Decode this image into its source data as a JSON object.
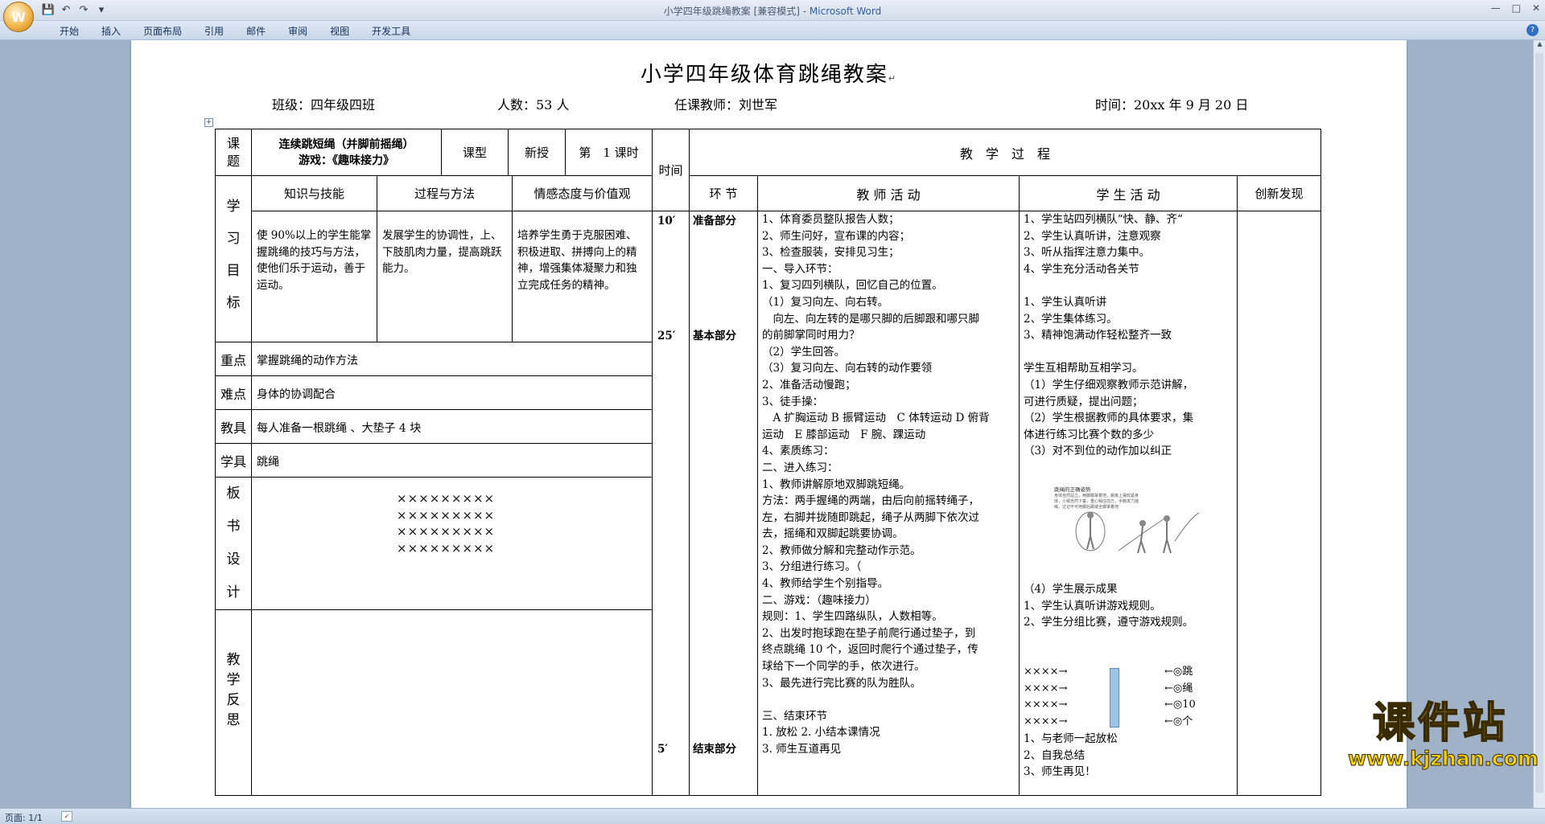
{
  "app": {
    "window_title": "小学四年级跳绳教案 [兼容模式] - ",
    "app_name": "Microsoft Word",
    "tabs": [
      "开始",
      "插入",
      "页面布局",
      "引用",
      "邮件",
      "审阅",
      "视图",
      "开发工具"
    ],
    "qat": [
      "save-icon",
      "undo-icon",
      "redo-icon",
      "customize-icon"
    ],
    "status": "页面: 1/1"
  },
  "doc": {
    "title": "小学四年级体育跳绳教案",
    "info": {
      "class": "班级：四年级四班",
      "count": "人数：53 人",
      "teacher": "任课教师：刘世军",
      "time": "时间：20xx 年 9 月 20 日"
    },
    "header": {
      "topic_label": "课\n题",
      "topic_line1": "连续跳短绳（并脚前摇绳）",
      "topic_line2": "游戏：《趣味接力》",
      "type_label": "课型",
      "type_value": "新授",
      "lesson_no": "第　1 课时",
      "time_label": "时间",
      "process_label": "教　学　过　程"
    },
    "subheader": {
      "goals_label": "学\n习\n目\n标",
      "knowledge": "知识与技能",
      "method": "过程与方法",
      "attitude": "情感态度与价值观",
      "segment": "环 节",
      "teacher_act": "教 师 活 动",
      "student_act": "学 生 活 动",
      "innovation": "创新发现"
    },
    "goals": {
      "knowledge": "使 90%以上的学生能掌握跳绳的技巧与方法，使他们乐于运动，善于运动。",
      "method": "发展学生的协调性，上、下肢肌肉力量，提高跳跃能力。",
      "attitude": "培养学生勇于克服困难、积极进取、拼搏向上的精神，增强集体凝聚力和独立完成任务的精神。"
    },
    "rows": {
      "key_label": "重点",
      "key_value": "掌握跳绳的动作方法",
      "diff_label": "难点",
      "diff_value": "身体的协调配合",
      "tools_label": "教具",
      "tools_value": "每人准备一根跳绳 、大垫子 4 块",
      "sup_label": "学具",
      "sup_value": "跳绳",
      "board_label": "板\n书\n设\n计",
      "board_lines": [
        "×××××××××",
        "×××××××××",
        "×××××××××",
        "×××××××××"
      ],
      "reflect_label": "教\n学\n反\n思"
    },
    "times": [
      "10′",
      "25′",
      "5′"
    ],
    "segments": [
      "准备部分",
      "基本部分",
      "结束部分"
    ],
    "teacher_lines": [
      "1、体育委员整队报告人数；",
      "2、师生问好，宣布课的内容；",
      "3、检查服装，安排见习生；",
      "一、导入环节：",
      "1、复习四列横队，回忆自己的位置。",
      "（1）复习向左、向右转。",
      "　向左、向左转的是哪只脚的后脚跟和哪只脚",
      "的前脚掌同时用力？",
      "（2）学生回答。",
      "（3）复习向左、向右转的动作要领",
      "2、准备活动慢跑；",
      "3、徒手操：",
      "　A 扩胸运动 B 振臂运动　C 体转运动 D 俯背",
      "运动　E 膝部运动　F 腕、踝运动",
      "4、素质练习：",
      "二、进入练习：",
      "1、教师讲解原地双脚跳短绳。",
      "方法：两手握绳的两端，由后向前摇转绳子，",
      "左，右脚并拢随即跳起，绳子从两脚下依次过",
      "去，摇绳和双脚起跳要协调。",
      "2、教师做分解和完整动作示范。",
      "3、分组进行练习。（",
      "4、教师给学生个别指导。",
      "二、游戏：（趣味接力）",
      "规则：1、学生四路纵队，人数相等。",
      "2、出发时抱球跑在垫子前爬行通过垫子，到",
      "终点跳绳 10 个，返回时爬行个通过垫子，传",
      "球给下一个同学的手，依次进行。",
      "3、最先进行完比赛的队为胜队。",
      "",
      "三、结束环节",
      "1. 放松 2. 小结本课情况",
      "3. 师生互道再见"
    ],
    "student_lines": [
      "1、学生站四列横队“快、静、齐“",
      "2、学生认真听讲，注意观察",
      "3、听从指挥注意力集中。",
      "4、学生充分活动各关节",
      "",
      "1、学生认真听讲",
      "2、学生集体练习。",
      "3、精神饱满动作轻松整齐一致",
      "",
      "学生互相帮助互相学习。",
      "（1）学生仔细观察教师示范讲解，",
      "可进行质疑，提出问题；",
      "（2）学生根据教师的具体要求，集",
      "体进行练习比赛个数的多少",
      "（3）对不到位的动作加以纠正"
    ],
    "student_lower": [
      "（4）学生展示成果",
      "1、学生认真听讲游戏规则。",
      "2、学生分组比赛，遵守游戏规则。"
    ],
    "formation_left": [
      "××××→",
      "××××→",
      "××××→",
      "××××→"
    ],
    "formation_right": [
      "←◎跳",
      "←◎绳",
      "←◎10",
      "←◎个"
    ],
    "student_end": [
      "1、与老师一起放松",
      "2、自我总结",
      "3、师生再见！"
    ],
    "illustration_caption": "跳绳的正确姿势",
    "illustration_text": [
      "身体自然站立，两脚脚掌着地，跳离上摆较紧身",
      "体，小臂自然下垂，重心稍往前方，手腕发力摇",
      "绳，过记不可用脚后跟或全脚掌着地"
    ]
  },
  "watermark": {
    "brand": "课件站",
    "url": "www.kjzhan.com"
  }
}
